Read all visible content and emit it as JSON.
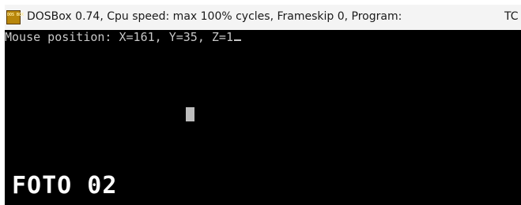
{
  "window": {
    "icon_label": "DOS BOX",
    "title": "DOSBox 0.74, Cpu speed: max 100% cycles, Frameskip  0, Program:",
    "title_overflow": "TC"
  },
  "console": {
    "line1": "Mouse position: X=161, Y=35, Z=1"
  },
  "overlay": {
    "caption": "FOTO 02"
  },
  "colors": {
    "screen_bg": "#000000",
    "console_text": "#c8c8c8",
    "mouse_cursor": "#bdbdbd",
    "caption_text": "#ffffff",
    "titlebar_bg": "#f4f4f4"
  },
  "icons": {
    "app_icon": "dosbox-app-icon",
    "mouse_cursor": "block-mouse-cursor"
  }
}
